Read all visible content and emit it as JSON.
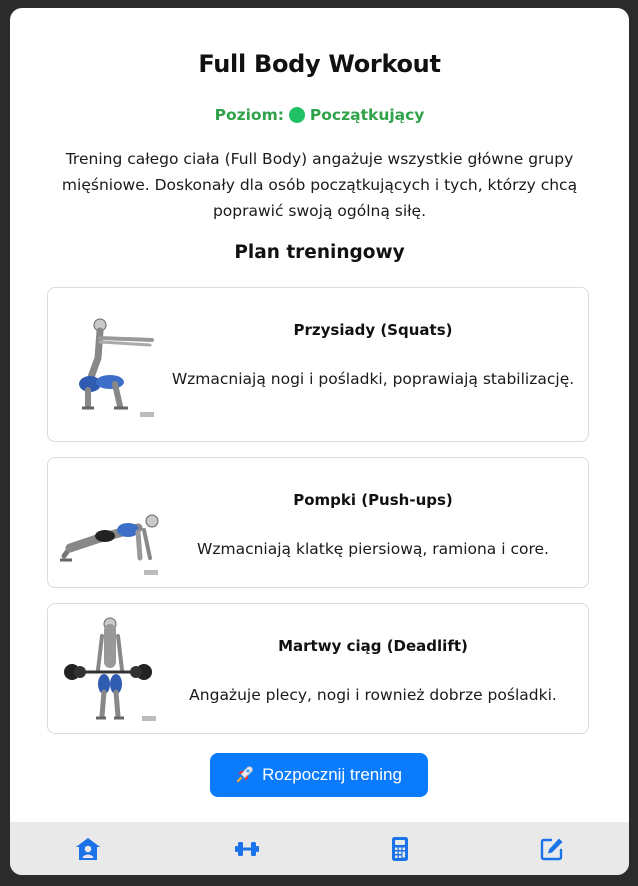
{
  "header": {
    "title": "Full Body Workout",
    "level_label": "Poziom:",
    "level_value": "Początkujący",
    "level_color": "#20c064"
  },
  "description": "Trening całego ciała (Full Body) angażuje wszystkie główne grupy mięśniowe. Doskonały dla osób początkujących i tych, którzy chcą poprawić swoją ogólną siłę.",
  "plan": {
    "title": "Plan treningowy",
    "exercises": [
      {
        "name": "Przysiady (Squats)",
        "description": "Wzmacniają nogi i pośladki, poprawiają stabilizację.",
        "image": "squat-illustration"
      },
      {
        "name": "Pompki (Push-ups)",
        "description": "Wzmacniają klatkę piersiową, ramiona i core.",
        "image": "pushup-illustration"
      },
      {
        "name": "Martwy ciąg (Deadlift)",
        "description": "Angażuje plecy, nogi i rownież dobrze pośladki.",
        "image": "deadlift-illustration"
      }
    ]
  },
  "start_button": {
    "icon": "rocket-icon",
    "label": "Rozpocznij trening",
    "color": "#0b7bfe"
  },
  "bottom_nav": {
    "items": [
      {
        "icon": "home-user-icon"
      },
      {
        "icon": "dumbbell-icon"
      },
      {
        "icon": "calculator-icon"
      },
      {
        "icon": "edit-icon"
      }
    ],
    "accent": "#1a73e8"
  }
}
